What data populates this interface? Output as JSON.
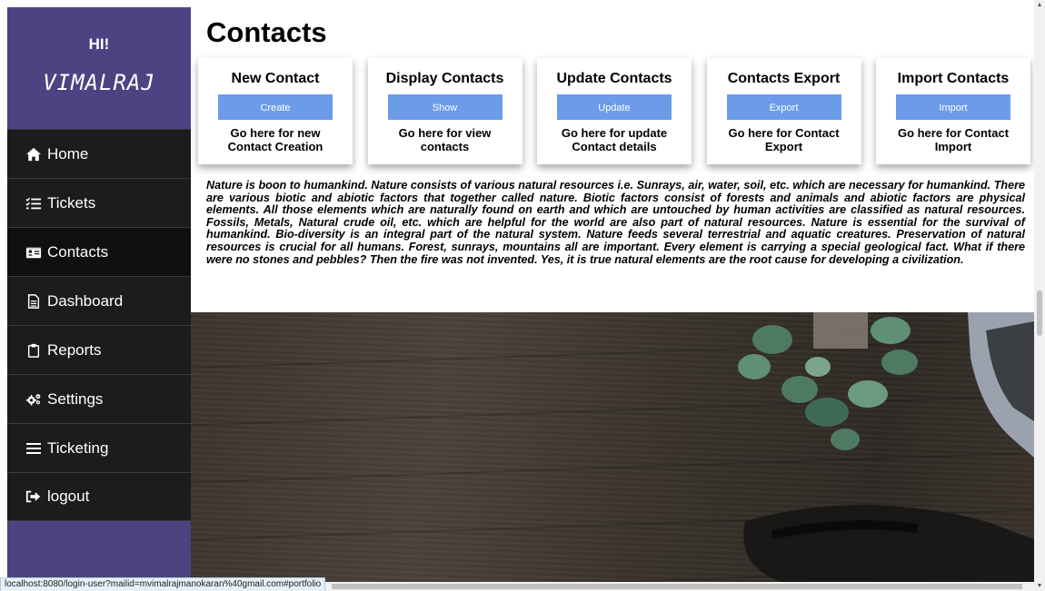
{
  "sidebar": {
    "greeting": "HI!",
    "username": "VIMALRAJ",
    "items": [
      {
        "label": "Home",
        "icon": "home-icon"
      },
      {
        "label": "Tickets",
        "icon": "checklist-icon"
      },
      {
        "label": "Contacts",
        "icon": "contact-card-icon"
      },
      {
        "label": "Dashboard",
        "icon": "file-text-icon"
      },
      {
        "label": "Reports",
        "icon": "clipboard-icon"
      },
      {
        "label": "Settings",
        "icon": "gears-icon"
      },
      {
        "label": "Ticketing",
        "icon": "menu-lines-icon"
      },
      {
        "label": "logout",
        "icon": "sign-out-icon"
      }
    ],
    "active": "Contacts"
  },
  "main": {
    "title": "Contacts",
    "cards": [
      {
        "title": "New Contact",
        "button": "Create",
        "desc": "Go here for new Contact Creation"
      },
      {
        "title": "Display Contacts",
        "button": "Show",
        "desc": "Go here for view contacts"
      },
      {
        "title": "Update Contacts",
        "button": "Update",
        "desc": "Go here for update Contact details"
      },
      {
        "title": "Contacts Export",
        "button": "Export",
        "desc": "Go here for Contact Export"
      },
      {
        "title": "Import Contacts",
        "button": "Import",
        "desc": "Go here for Contact Import"
      }
    ],
    "paragraph": "Nature is boon to humankind. Nature consists of various natural resources i.e. Sunrays, air, water, soil, etc. which are necessary for humankind. There are various biotic and abiotic factors that together called nature. Biotic factors consist of forests and animals and abiotic factors are physical elements. All those elements which are naturally found on earth and which are untouched by human activities are classified as natural resources. Fossils, Metals, Natural crude oil, etc. which are helpful for the world are also part of natural resources. Nature is essential for the survival of humankind. Bio-diversity is an integral part of the natural system. Nature feeds several terrestrial and aquatic creatures. Preservation of natural resources is crucial for all humans. Forest, sunrays, mountains all are important. Every element is carrying a special geological fact. What if there were no stones and pebbles? Then the fire was not invented. Yes, it is true natural elements are the root cause for developing a civilization."
  },
  "statusbar": {
    "url": "localhost:8080/login-user?mailid=mvimalrajmanokaran%40gmail.com#portfolio"
  },
  "colors": {
    "sidebar_purple": "#4d4382",
    "nav_dark": "#1c1c1c",
    "button_blue": "#6b9be9"
  }
}
